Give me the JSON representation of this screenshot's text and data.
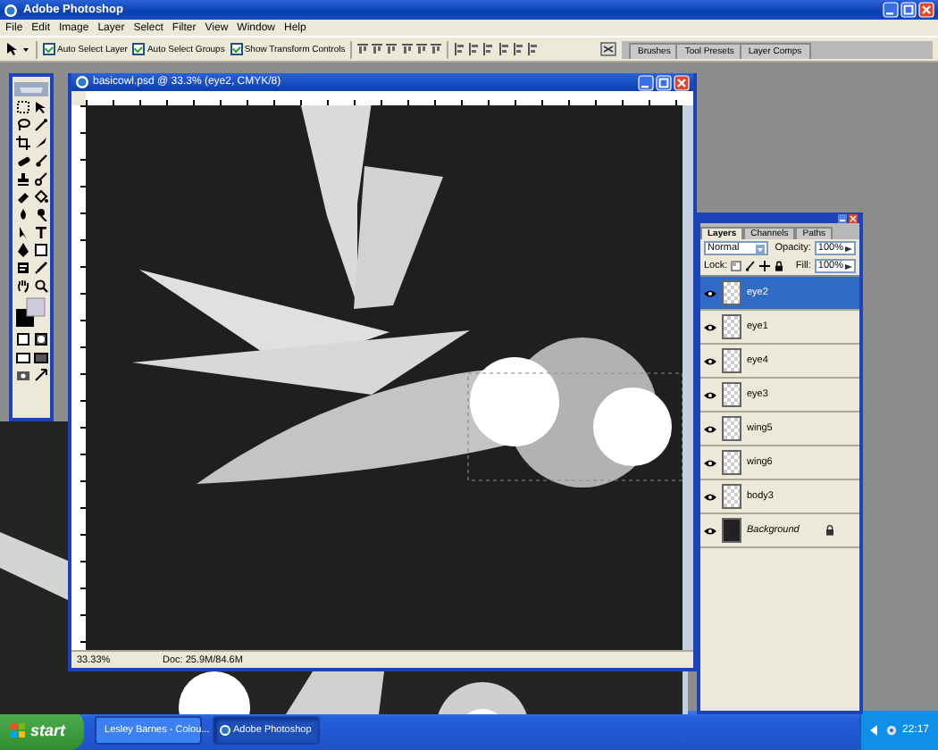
{
  "app": {
    "title": "Adobe Photoshop"
  },
  "menu": [
    "File",
    "Edit",
    "Image",
    "Layer",
    "Select",
    "Filter",
    "View",
    "Window",
    "Help"
  ],
  "options": {
    "checkboxes": [
      {
        "label": "Auto Select Layer",
        "checked": true
      },
      {
        "label": "Auto Select Groups",
        "checked": true
      },
      {
        "label": "Show Transform Controls",
        "checked": true
      }
    ]
  },
  "palette_well": {
    "tabs": [
      "Brushes",
      "Tool Presets",
      "Layer Comps"
    ]
  },
  "document": {
    "title": "basicowl.psd @ 33.3% (eye2, CMYK/8)",
    "zoom": "33.33%",
    "doc_info": "Doc: 25.9M/84.6M"
  },
  "layers_panel": {
    "tabs": [
      {
        "label": "Layers",
        "selected": true
      },
      {
        "label": "Channels",
        "selected": false
      },
      {
        "label": "Paths",
        "selected": false
      }
    ],
    "blend_mode": "Normal",
    "opacity_label": "Opacity:",
    "opacity": "100%",
    "lock_label": "Lock:",
    "fill_label": "Fill:",
    "fill": "100%",
    "layers": [
      {
        "name": "eye2",
        "selected": true,
        "visible": true,
        "kind": "transparent",
        "locked": false
      },
      {
        "name": "eye1",
        "selected": false,
        "visible": true,
        "kind": "transparent",
        "locked": false
      },
      {
        "name": "eye4",
        "selected": false,
        "visible": true,
        "kind": "transparent",
        "locked": false
      },
      {
        "name": "eye3",
        "selected": false,
        "visible": true,
        "kind": "transparent",
        "locked": false
      },
      {
        "name": "wing5",
        "selected": false,
        "visible": true,
        "kind": "transparent",
        "locked": false
      },
      {
        "name": "wing6",
        "selected": false,
        "visible": true,
        "kind": "transparent",
        "locked": false
      },
      {
        "name": "body3",
        "selected": false,
        "visible": true,
        "kind": "transparent",
        "locked": false
      },
      {
        "name": "Background",
        "selected": false,
        "visible": true,
        "kind": "background",
        "locked": true
      }
    ]
  },
  "taskbar": {
    "start": "start",
    "items": [
      {
        "label": "Lesley Barnes - Colou...",
        "selected": false
      },
      {
        "label": "Adobe Photoshop",
        "selected": true
      }
    ],
    "clock": "22:17"
  }
}
